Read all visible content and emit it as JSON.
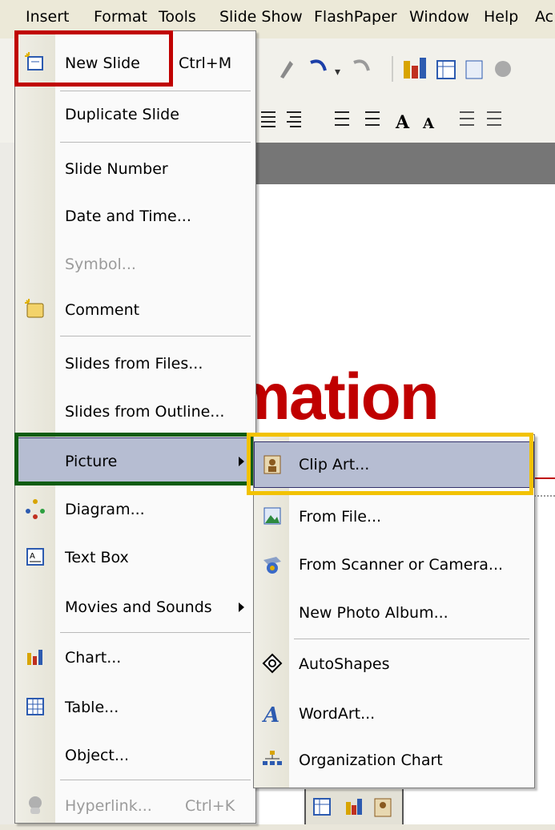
{
  "menubar": {
    "items": [
      {
        "id": "insert",
        "label": "Insert"
      },
      {
        "id": "format",
        "label": "Format"
      },
      {
        "id": "tools",
        "label": "Tools"
      },
      {
        "id": "slideshow",
        "label": "Slide Show"
      },
      {
        "id": "flashpaper",
        "label": "FlashPaper"
      },
      {
        "id": "window",
        "label": "Window"
      },
      {
        "id": "help",
        "label": "Help"
      },
      {
        "id": "ac",
        "label": "Ac"
      }
    ]
  },
  "slide": {
    "title_fragment": "mation"
  },
  "insert_menu": {
    "items": [
      {
        "label": "New Slide",
        "shortcut": "Ctrl+M",
        "icon": "new-slide-icon"
      },
      {
        "label": "Duplicate Slide"
      },
      {
        "label": "Slide Number"
      },
      {
        "label": "Date and Time..."
      },
      {
        "label": "Symbol...",
        "disabled": true
      },
      {
        "label": "Comment",
        "icon": "comment-icon"
      },
      {
        "label": "Slides from Files..."
      },
      {
        "label": "Slides from Outline..."
      },
      {
        "label": "Picture",
        "submenu": true,
        "highlighted": true
      },
      {
        "label": "Diagram...",
        "icon": "diagram-icon"
      },
      {
        "label": "Text Box",
        "icon": "text-box-icon"
      },
      {
        "label": "Movies and Sounds",
        "submenu": true
      },
      {
        "label": "Chart...",
        "icon": "chart-icon"
      },
      {
        "label": "Table...",
        "icon": "table-icon"
      },
      {
        "label": "Object..."
      },
      {
        "label": "Hyperlink...",
        "shortcut": "Ctrl+K",
        "disabled": true,
        "icon": "hyperlink-icon"
      }
    ]
  },
  "picture_submenu": {
    "items": [
      {
        "label": "Clip Art...",
        "icon": "clip-art-icon",
        "highlighted": true
      },
      {
        "label": "From File...",
        "icon": "from-file-icon"
      },
      {
        "label": "From Scanner or Camera...",
        "icon": "scanner-camera-icon"
      },
      {
        "label": "New Photo Album..."
      },
      {
        "label": "AutoShapes",
        "icon": "autoshapes-icon"
      },
      {
        "label": "WordArt...",
        "icon": "wordart-icon"
      },
      {
        "label": "Organization Chart",
        "icon": "org-chart-icon"
      }
    ]
  },
  "colors": {
    "highlight_box_red": "#c00000",
    "highlight_box_green": "#0d5c12",
    "highlight_box_yellow": "#f2c200",
    "menu_hover": "#b6bdd2",
    "title_red": "#c00000"
  }
}
